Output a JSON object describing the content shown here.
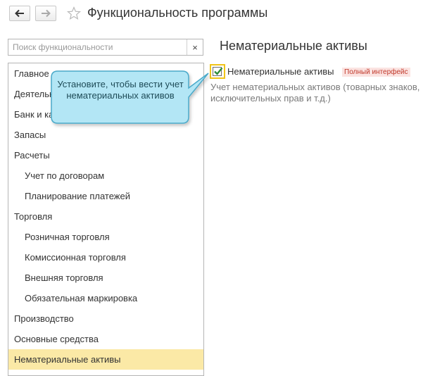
{
  "header": {
    "title": "Функциональность программы",
    "back_icon": "arrow-left-icon",
    "forward_icon": "arrow-right-icon",
    "favorite_icon": "star-icon"
  },
  "search": {
    "placeholder": "Поиск функциональности",
    "clear_label": "×"
  },
  "sidebar": {
    "items": [
      {
        "label": "Главное",
        "level": 1,
        "selected": false
      },
      {
        "label": "Деятельность",
        "level": 1,
        "selected": false
      },
      {
        "label": "Банк и касса",
        "level": 1,
        "selected": false
      },
      {
        "label": "Запасы",
        "level": 1,
        "selected": false
      },
      {
        "label": "Расчеты",
        "level": 1,
        "selected": false
      },
      {
        "label": "Учет по договорам",
        "level": 2,
        "selected": false
      },
      {
        "label": "Планирование платежей",
        "level": 2,
        "selected": false
      },
      {
        "label": "Торговля",
        "level": 1,
        "selected": false
      },
      {
        "label": "Розничная торговля",
        "level": 2,
        "selected": false
      },
      {
        "label": "Комиссионная торговля",
        "level": 2,
        "selected": false
      },
      {
        "label": "Внешняя торговля",
        "level": 2,
        "selected": false
      },
      {
        "label": "Обязательная маркировка",
        "level": 2,
        "selected": false
      },
      {
        "label": "Производство",
        "level": 1,
        "selected": false
      },
      {
        "label": "Основные средства",
        "level": 1,
        "selected": false
      },
      {
        "label": "Нематериальные активы",
        "level": 1,
        "selected": true
      }
    ],
    "selected_color": "#fbe9a6"
  },
  "main": {
    "section_title": "Нематериальные активы",
    "option": {
      "checked": true,
      "label": "Нематериальные активы",
      "badge": "Полный интерфейс",
      "description": "Учет нематериальных активов (товарных знаков, исключительных прав и т.д.)"
    }
  },
  "callout": {
    "text": "Установите, чтобы вести учет нематериальных активов",
    "fill_color": "#b3e6f5",
    "border_color": "#4aa9c9"
  }
}
